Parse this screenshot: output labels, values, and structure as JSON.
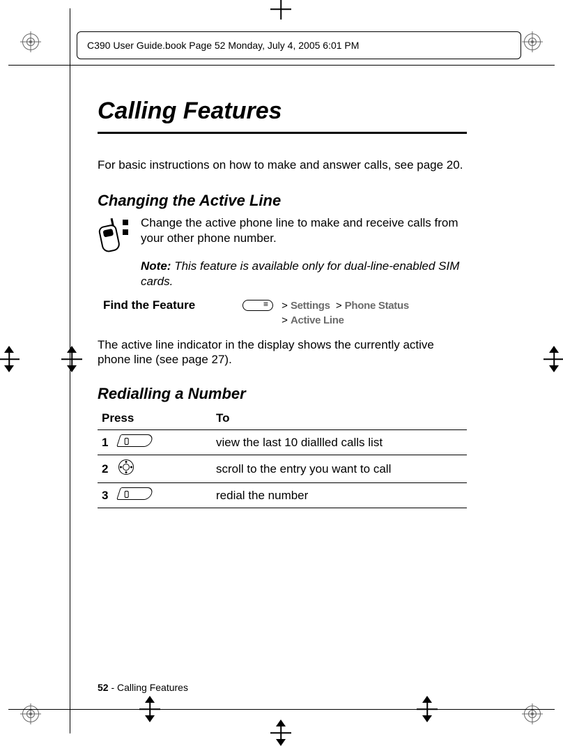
{
  "header_info": "C390 User Guide.book  Page 52  Monday, July 4, 2005  6:01 PM",
  "title": "Calling Features",
  "intro": "For basic instructions on how to make and answer calls, see page 20.",
  "section1": {
    "heading": "Changing the Active Line",
    "icon_text": "Change the active phone line to make and receive calls from your other phone number.",
    "note_label": "Note:",
    "note_body": "This feature is available only for dual-line-enabled SIM cards.",
    "find_label": "Find the Feature",
    "path": {
      "seg1": "Settings",
      "seg2": "Phone Status",
      "seg3": "Active Line"
    },
    "after": "The active line indicator in the display shows the currently active phone line (see page 27)."
  },
  "section2": {
    "heading": "Redialling a Number",
    "col1": "Press",
    "col2": "To",
    "rows": [
      {
        "n": "1",
        "key": "send-key",
        "desc": "view the last 10 diallled calls list"
      },
      {
        "n": "2",
        "key": "nav-key",
        "desc": "scroll to the entry you want to call"
      },
      {
        "n": "3",
        "key": "send-key",
        "desc": "redial the number"
      }
    ]
  },
  "footer": {
    "page": "52",
    "sep": " - ",
    "section": "Calling Features"
  }
}
